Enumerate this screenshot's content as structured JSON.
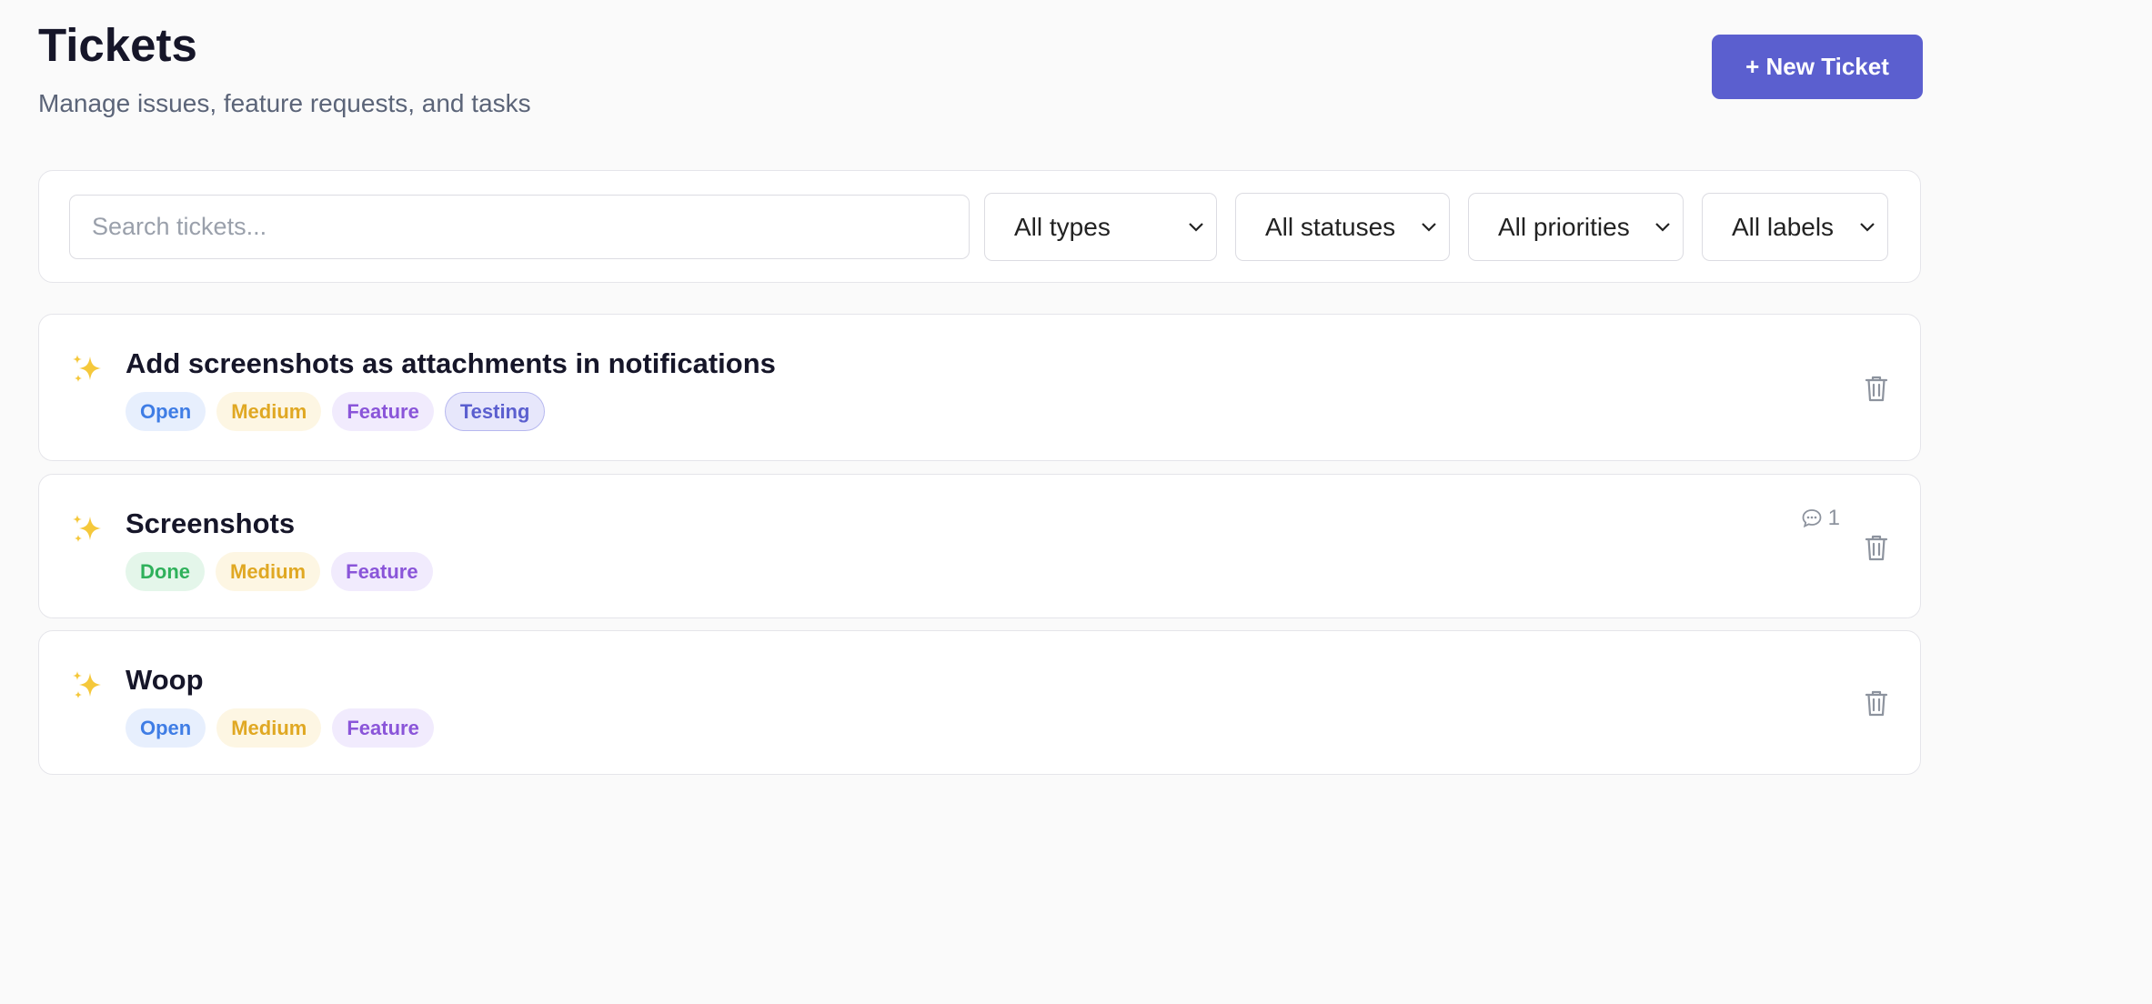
{
  "header": {
    "title": "Tickets",
    "subtitle": "Manage issues, feature requests, and tasks",
    "new_ticket_label": "+ New Ticket"
  },
  "filters": {
    "search_placeholder": "Search tickets...",
    "search_value": "",
    "type_selected": "All types",
    "status_selected": "All statuses",
    "priority_selected": "All priorities",
    "label_selected": "All labels"
  },
  "tickets": [
    {
      "icon": "sparkles-icon",
      "title": "Add screenshots as attachments in notifications",
      "status": "Open",
      "priority": "Medium",
      "type": "Feature",
      "label": "Testing"
    },
    {
      "icon": "sparkles-icon",
      "title": "Screenshots",
      "status": "Done",
      "priority": "Medium",
      "type": "Feature",
      "comment_count": "1"
    },
    {
      "icon": "sparkles-icon",
      "title": "Woop",
      "status": "Open",
      "priority": "Medium",
      "type": "Feature"
    }
  ],
  "colors": {
    "accent": "#5b5fcf",
    "background": "#fafafa",
    "status_open": "#3f7de5",
    "status_done": "#2fb15b",
    "priority_medium": "#e0a823",
    "type_feature": "#8a55d9"
  }
}
